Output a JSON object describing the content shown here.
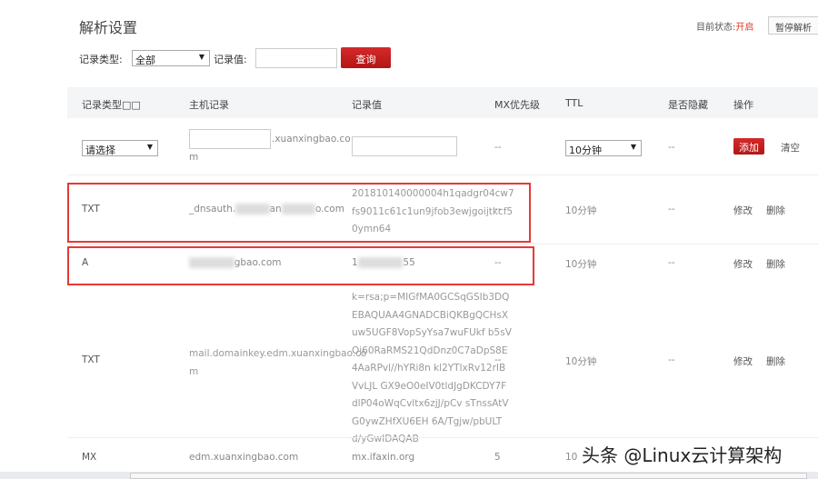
{
  "page": {
    "title": "解析设置",
    "status_label": "目前状态:",
    "status_value": "开启",
    "pause_button": "暂停解析"
  },
  "filter": {
    "type_label": "记录类型:",
    "type_value": "全部",
    "value_label": "记录值:",
    "value_input": "",
    "query_button": "查询"
  },
  "table": {
    "headers": [
      "记录类型□□",
      "主机记录",
      "记录值",
      "MX优先级",
      "TTL",
      "是否隐藏",
      "操作"
    ],
    "add_row": {
      "type_select": "请选择",
      "host_input": "",
      "host_suffix": ".xuanxingbao.co",
      "host_suffix2": "m",
      "value_input": "",
      "mx": "--",
      "ttl_select": "10分钟",
      "hidden": "--",
      "add_button": "添加",
      "clear_link": "清空"
    },
    "rows": [
      {
        "type": "TXT",
        "host_prefix": "_dnsauth.",
        "host_mid": "an",
        "host_suffix": "o.com",
        "value_lines": [
          "201810140000004h1qadgr04cw7",
          "fs9011c61c1un9jfob3ewjgoijtkcf5",
          "0ymn64"
        ],
        "mx": "--",
        "ttl": "10分钟",
        "hidden": "--",
        "edit": "修改",
        "delete": "删除"
      },
      {
        "type": "A",
        "host_suffix": "gbao.com",
        "value_prefix": "1",
        "value_suffix": "55",
        "mx": "--",
        "ttl": "10分钟",
        "hidden": "--",
        "edit": "修改",
        "delete": "删除"
      },
      {
        "type": "TXT",
        "host_lines": [
          "mail.domainkey.edm.xuanxingbao.co",
          "m"
        ],
        "value_lines": [
          "k=rsa;p=MIGfMA0GCSqGSIb3DQ",
          "EBAQUAA4GNADCBiQKBgQCHsX",
          "uw5UGF8VopSyYsa7wuFUkf b5sV",
          "Oj60RaRMS21QdDnz0C7aDpS8E",
          "4AaRPvl//hYRi8n kl2YTlxRv12rIB",
          "VvLJL GX9eO0eIV0tldJgDKCDY7F",
          "dlP04oWqCvltx6zjJ/pCv sTnssAtV",
          "G0ywZHfXU6EH 6A/Tgjw/pbULT",
          "d/yGwIDAQAB"
        ],
        "mx": "--",
        "ttl": "10分钟",
        "hidden": "--",
        "edit": "修改",
        "delete": "删除"
      },
      {
        "type": "MX",
        "host": "edm.xuanxingbao.com",
        "value": "mx.ifaxin.org",
        "mx": "5",
        "ttl": "10"
      }
    ]
  },
  "watermark": "头条 @Linux云计算架构"
}
